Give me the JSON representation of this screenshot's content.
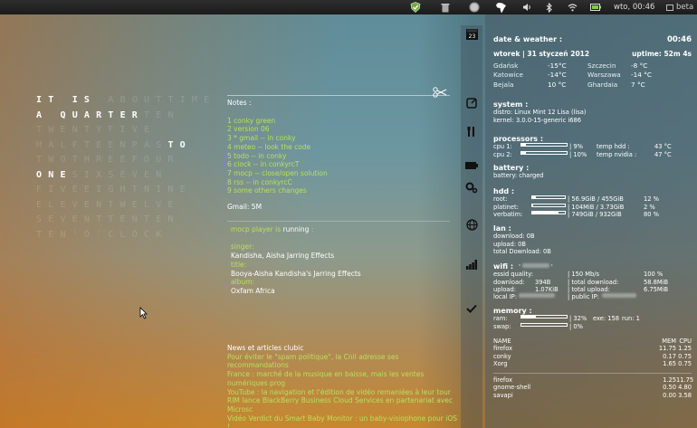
{
  "panel": {
    "time": "wto, 00:46",
    "beta": "beta"
  },
  "clock": {
    "lines": [
      [
        {
          "t": "IT",
          "on": true
        },
        {
          "t": " ",
          "on": false
        },
        {
          "t": "IS",
          "on": true
        },
        {
          "t": " ",
          "on": false
        },
        {
          "t": "ABOUTTIME",
          "on": false
        }
      ],
      [
        {
          "t": "A",
          "on": true
        },
        {
          "t": " ",
          "on": false
        },
        {
          "t": "QUARTER",
          "on": true
        },
        {
          "t": "TEN",
          "on": false
        }
      ],
      [
        {
          "t": "TWENTYFIVE",
          "on": false
        },
        {
          "t": "",
          "on": false
        }
      ],
      [
        {
          "t": "HALFTEENPAS",
          "on": false
        },
        {
          "t": "TO",
          "on": true
        }
      ],
      [
        {
          "t": "TWOTHREEFOUR",
          "on": false
        }
      ],
      [
        {
          "t": "ONE",
          "on": true
        },
        {
          "t": "SIXSEVEN",
          "on": false
        }
      ],
      [
        {
          "t": "FIVEEIGHTNINE",
          "on": false
        }
      ],
      [
        {
          "t": "ELEVENTWELVE",
          "on": false
        }
      ],
      [
        {
          "t": "SEVENTTENTEN",
          "on": false
        }
      ],
      [
        {
          "t": "TEN'O'CLOCK",
          "on": false
        }
      ]
    ]
  },
  "notes": {
    "title": "Notes :",
    "items": [
      "1 conky green",
      "2 version 06",
      "3 * gmail -- in conky",
      "4 meteo -- look the code",
      "5 todo -- in conky",
      "6 clock -- in conkyrcT",
      "7 mocp -- close/open solution",
      "8 rss -- in conkyrcC",
      "9 some others changes"
    ],
    "gmail": "Gmail: 5M"
  },
  "mocp": {
    "prefix": "mocp player is ",
    "state": "running",
    "suffix": " :",
    "singer_label": "singer:",
    "singer": "Kandisha, Aisha Jarring Effects",
    "title_label": "title:",
    "title": "Booya-Aisha Kandisha's Jarring Effects",
    "album_label": "album:",
    "album": "Oxfam Africa"
  },
  "news": {
    "title": "News et articles clubic",
    "items": [
      "Pour éviter le \"spam politique\", la Cnil adresse ses recommandations",
      "France : marché de la musique en baisse, mais les ventes numériques prog",
      "YouTube : la navigation et l'édition de vidéo remaniées à leur tour",
      "RIM lance BlackBerry Business Cloud Services en partenariat avec Microsc",
      "Vidéo Verdict du Smart Baby Monitor : un baby-visiophone pour iOS !"
    ]
  },
  "dock": {
    "badge": "23"
  },
  "weather": {
    "head": "date & weather :",
    "time": "00:46",
    "date": "wtorek | 31 styczeń 2012",
    "uptime": "uptime: 52m 4s",
    "cities": [
      [
        "Gdańsk",
        "-15°C",
        "Szczecin",
        "-8 °C"
      ],
      [
        "Katowice",
        "-14°C",
        "Warszawa",
        "-14 °C"
      ],
      [
        "Bejaïa",
        "10 °C",
        "Ghardaia",
        "7 °C"
      ]
    ]
  },
  "system": {
    "head": "system :",
    "distro": "distro: Linux Mint 12 Lisa (lisa)",
    "kernel": "kernel: 3.0.0-15-generic i686"
  },
  "proc": {
    "head": "processors :",
    "rows": [
      {
        "name": "cpu 1:",
        "pct": "| 9%",
        "pv": 0.09,
        "tl": "temp hdd :",
        "tv": "43 °C"
      },
      {
        "name": "cpu 2:",
        "pct": "| 10%",
        "pv": 0.1,
        "tl": "temp nvidia :",
        "tv": "47 °C"
      }
    ]
  },
  "battery": {
    "head": "battery :",
    "state": "battery: charged"
  },
  "hdd": {
    "head": "hdd :",
    "rows": [
      {
        "name": "root:",
        "val": "| 56.9GiB / 455GiB",
        "pv": 0.12,
        "pct": "12 %"
      },
      {
        "name": "platinet:",
        "val": "| 104MiB / 3.73GiB",
        "pv": 0.02,
        "pct": "2 %"
      },
      {
        "name": "verbatim:",
        "val": "| 749GiB / 932GiB",
        "pv": 0.8,
        "pct": "80 %"
      }
    ]
  },
  "lan": {
    "head": "lan :",
    "down": "download: 0B",
    "up": "upload: 0B",
    "total": "total Download: 0B"
  },
  "wifi": {
    "head": "wifi :",
    "essid_label": "essid quality:",
    "rate": "| 150 Mb/s",
    "quality": "100 %",
    "download": "download:",
    "dl": "394B",
    "total_dl_label": "| total download:",
    "total_dl": "58.8MiB",
    "upload": "upload:",
    "ul": "1.07KiB",
    "total_ul_label": "| total upload:",
    "total_ul": "6.75MiB",
    "local_ip": "local IP:",
    "public_ip": "| public IP:"
  },
  "memory": {
    "head": "memory :",
    "ram": "ram:",
    "ram_pct": "| 32%",
    "ram_pv": 0.32,
    "exe": "exe: 158",
    "run": "run: 1",
    "swap": "swap:",
    "swap_pct": "| 0%",
    "swap_pv": 0
  },
  "procs": {
    "head": [
      "NAME",
      "MEM",
      "CPU"
    ],
    "rows": [
      [
        "firefox",
        "11.75",
        "1.25"
      ],
      [
        "conky",
        "0.17",
        "0.75"
      ],
      [
        "Xorg",
        "1.65",
        "0.75"
      ]
    ],
    "rows2": [
      [
        "firefox",
        "1.25",
        "11.75"
      ],
      [
        "gnome-shell",
        "0.50",
        "4.80"
      ],
      [
        "savapi",
        "0.00",
        "3.58"
      ]
    ]
  }
}
